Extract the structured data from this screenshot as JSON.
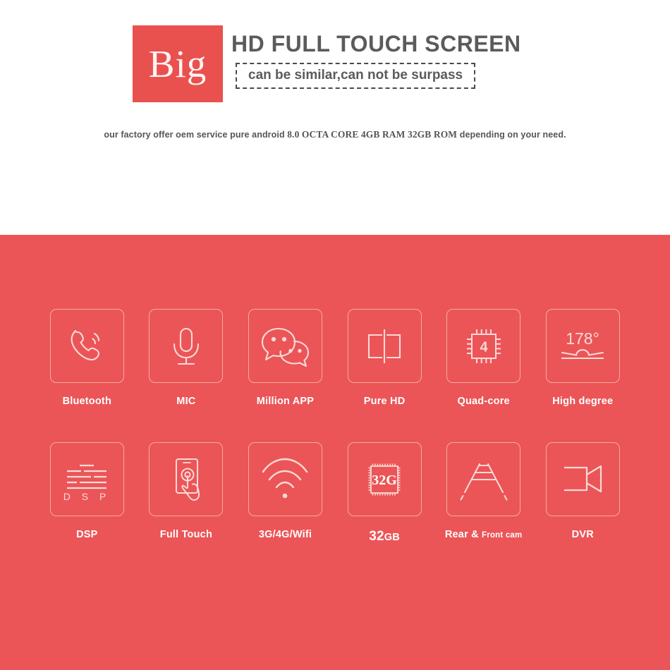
{
  "header": {
    "badge_text": "Big",
    "headline": "HD FULL TOUCH SCREEN",
    "tagline": "can be similar,can not be surpass",
    "subtitle_lead": "our factory offer oem service pure android ",
    "subtitle_spec": "8.0 OCTA CORE 4GB RAM 32GB ROM",
    "subtitle_tail": " depending on your need."
  },
  "colors": {
    "brand_red": "#eb5557",
    "badge_red": "#e9514f",
    "tile_border": "#f5a9a5",
    "heading_gray": "#5b5b5b",
    "label_white": "#ffffff"
  },
  "features": {
    "row1": [
      {
        "icon": "phone-handset-icon",
        "label": "Bluetooth"
      },
      {
        "icon": "microphone-icon",
        "label": "MIC"
      },
      {
        "icon": "chat-bubbles-icon",
        "label": "Million APP"
      },
      {
        "icon": "split-screen-icon",
        "label": "Pure HD"
      },
      {
        "icon": "cpu-chip-icon",
        "label": "Quad-core",
        "icon_text": "4"
      },
      {
        "icon": "viewing-angle-icon",
        "label": "High degree",
        "icon_text": "178°"
      }
    ],
    "row2": [
      {
        "icon": "equalizer-icon",
        "label": "DSP",
        "icon_text": "D S P"
      },
      {
        "icon": "touch-hand-phone-icon",
        "label": "Full Touch"
      },
      {
        "icon": "wifi-signal-icon",
        "label": "3G/4G/Wifi"
      },
      {
        "icon": "memory-chip-icon",
        "label_big": "32",
        "label_small": "GB",
        "icon_text": "32G"
      },
      {
        "icon": "parking-guideline-icon",
        "label_main": "Rear & ",
        "label_sub": "Front cam"
      },
      {
        "icon": "video-camera-icon",
        "label": "DVR"
      }
    ]
  }
}
